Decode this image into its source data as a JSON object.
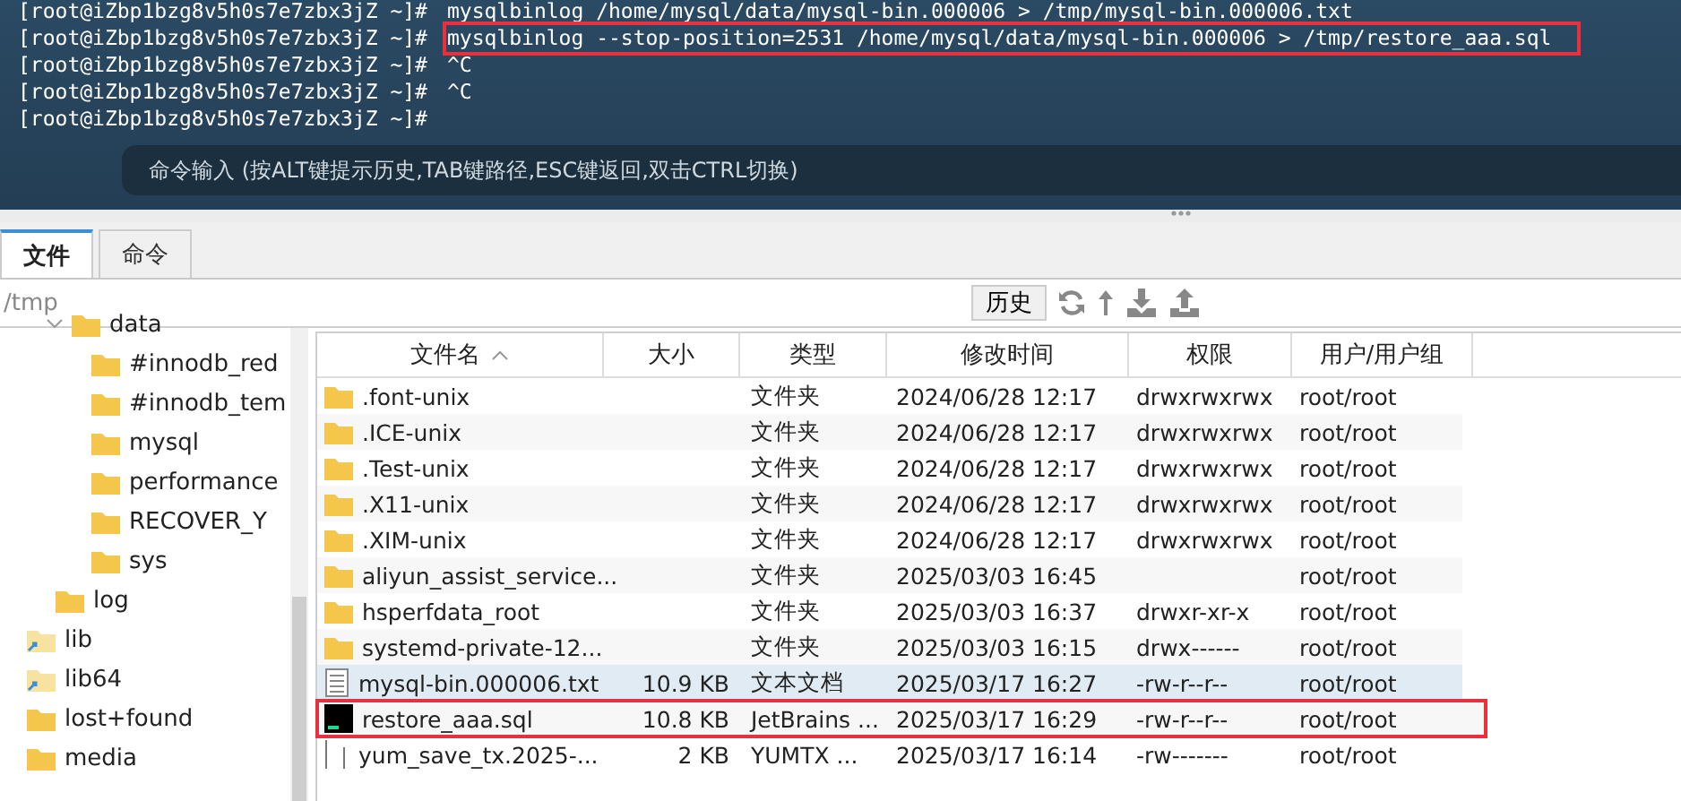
{
  "terminal": {
    "lines": [
      {
        "prompt": "[root@iZbp1bzg8v5h0s7e7zbx3jZ ~]#",
        "command": "mysqlbinlog /home/mysql/data/mysql-bin.000006 > /tmp/mysql-bin.000006.txt",
        "highlighted": false
      },
      {
        "prompt": "[root@iZbp1bzg8v5h0s7e7zbx3jZ ~]#",
        "command": "mysqlbinlog --stop-position=2531 /home/mysql/data/mysql-bin.000006 > /tmp/restore_aaa.sql",
        "highlighted": true
      },
      {
        "prompt": "[root@iZbp1bzg8v5h0s7e7zbx3jZ ~]#",
        "command": "^C",
        "highlighted": false
      },
      {
        "prompt": "[root@iZbp1bzg8v5h0s7e7zbx3jZ ~]#",
        "command": "^C",
        "highlighted": false
      },
      {
        "prompt": "[root@iZbp1bzg8v5h0s7e7zbx3jZ ~]#",
        "highlighted": false
      }
    ],
    "input_hint": "命令输入 (按ALT键提示历史,TAB键路径,ESC键返回,双击CTRL切换)"
  },
  "tabs": [
    {
      "label": "文件",
      "selected": true
    },
    {
      "label": "命令",
      "selected": false
    }
  ],
  "path": {
    "value": "/tmp",
    "history_button": "历史"
  },
  "tree": {
    "items": [
      {
        "children": [
          {
            "name": "data",
            "kind": "folder",
            "expanded": true,
            "children": [
              {
                "name": "#innodb_red",
                "kind": "folder"
              },
              {
                "name": "#innodb_tem",
                "kind": "folder"
              },
              {
                "name": "mysql",
                "kind": "folder"
              },
              {
                "name": "performance",
                "kind": "folder"
              },
              {
                "name": "RECOVER_Y",
                "kind": "folder"
              },
              {
                "name": "sys",
                "kind": "folder"
              }
            ]
          },
          {
            "name": "log",
            "kind": "folder"
          }
        ]
      },
      {
        "name": "lib",
        "kind": "link"
      },
      {
        "name": "lib64",
        "kind": "link"
      },
      {
        "name": "lost+found",
        "kind": "folder"
      },
      {
        "name": "media",
        "kind": "folder"
      }
    ]
  },
  "table": {
    "columns": [
      "文件名",
      "大小",
      "类型",
      "修改时间",
      "权限",
      "用户/用户组"
    ],
    "rows": [
      {
        "kind": "folder",
        "name": ".font-unix",
        "size": "",
        "type": "文件夹",
        "modified": "2024/06/28 12:17",
        "permissions": "drwxrwxrwx",
        "owner": "root/root",
        "selected": false,
        "highlighted": false
      },
      {
        "kind": "folder",
        "name": ".ICE-unix",
        "size": "",
        "type": "文件夹",
        "modified": "2024/06/28 12:17",
        "permissions": "drwxrwxrwx",
        "owner": "root/root",
        "selected": false,
        "highlighted": false
      },
      {
        "kind": "folder",
        "name": ".Test-unix",
        "size": "",
        "type": "文件夹",
        "modified": "2024/06/28 12:17",
        "permissions": "drwxrwxrwx",
        "owner": "root/root",
        "selected": false,
        "highlighted": false
      },
      {
        "kind": "folder",
        "name": ".X11-unix",
        "size": "",
        "type": "文件夹",
        "modified": "2024/06/28 12:17",
        "permissions": "drwxrwxrwx",
        "owner": "root/root",
        "selected": false,
        "highlighted": false
      },
      {
        "kind": "folder",
        "name": ".XIM-unix",
        "size": "",
        "type": "文件夹",
        "modified": "2024/06/28 12:17",
        "permissions": "drwxrwxrwx",
        "owner": "root/root",
        "selected": false,
        "highlighted": false
      },
      {
        "kind": "folder",
        "name": "aliyun_assist_service...",
        "size": "",
        "type": "文件夹",
        "modified": "2025/03/03 16:45",
        "permissions": "",
        "owner": "root/root",
        "selected": false,
        "highlighted": false
      },
      {
        "kind": "folder",
        "name": "hsperfdata_root",
        "size": "",
        "type": "文件夹",
        "modified": "2025/03/03 16:37",
        "permissions": "drwxr-xr-x",
        "owner": "root/root",
        "selected": false,
        "highlighted": false
      },
      {
        "kind": "folder",
        "name": "systemd-private-12...",
        "size": "",
        "type": "文件夹",
        "modified": "2025/03/03 16:15",
        "permissions": "drwx------",
        "owner": "root/root",
        "selected": false,
        "highlighted": false
      },
      {
        "kind": "text",
        "name": "mysql-bin.000006.txt",
        "size": "10.9 KB",
        "type": "文本文档",
        "modified": "2025/03/17 16:27",
        "permissions": "-rw-r--r--",
        "owner": "root/root",
        "selected": true,
        "highlighted": false
      },
      {
        "kind": "app",
        "name": "restore_aaa.sql",
        "size": "10.8 KB",
        "type": "JetBrains ...",
        "modified": "2025/03/17 16:29",
        "permissions": "-rw-r--r--",
        "owner": "root/root",
        "selected": false,
        "highlighted": true
      },
      {
        "kind": "blank",
        "name": "yum_save_tx.2025-...",
        "size": "2 KB",
        "type": "YUMTX ...",
        "modified": "2025/03/17 16:14",
        "permissions": "-rw-------",
        "owner": "root/root",
        "selected": false,
        "highlighted": false
      }
    ]
  }
}
